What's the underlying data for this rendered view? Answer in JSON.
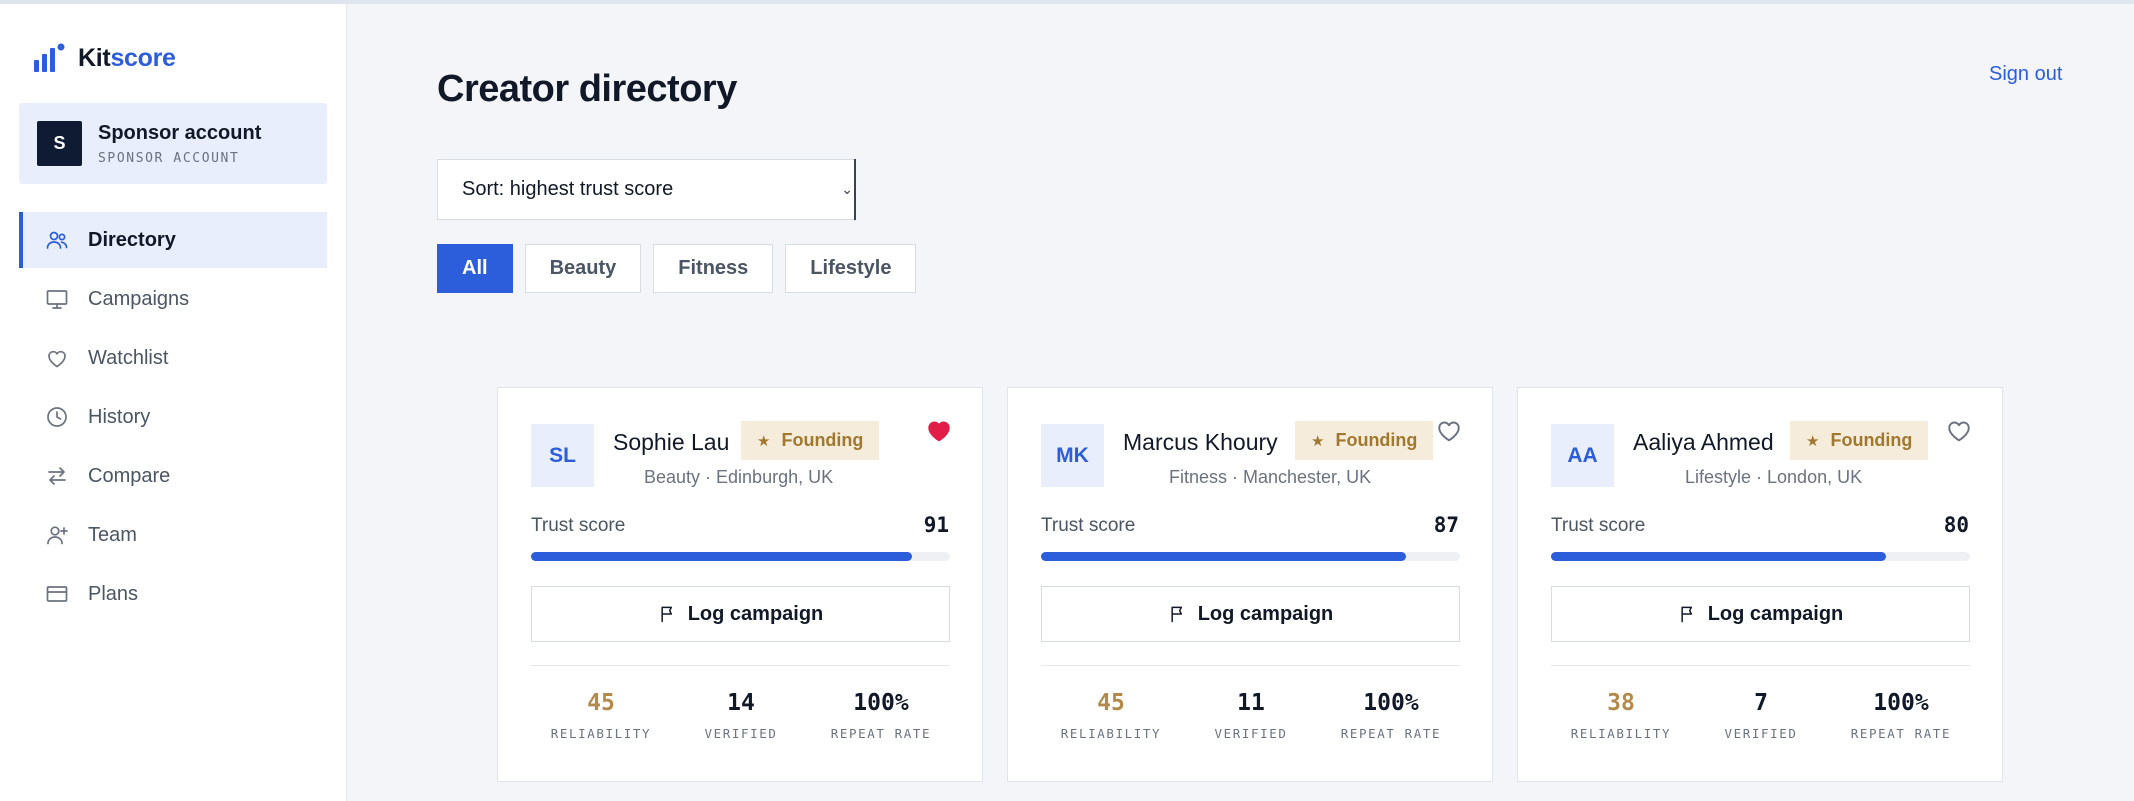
{
  "brand": {
    "prefix": "Kit",
    "accent": "score"
  },
  "account": {
    "initial": "S",
    "name": "Sponsor account",
    "role": "SPONSOR ACCOUNT"
  },
  "nav": [
    {
      "label": "Directory",
      "icon": "users-icon",
      "active": true
    },
    {
      "label": "Campaigns",
      "icon": "monitor-icon",
      "active": false
    },
    {
      "label": "Watchlist",
      "icon": "heart-icon",
      "active": false
    },
    {
      "label": "History",
      "icon": "clock-icon",
      "active": false
    },
    {
      "label": "Compare",
      "icon": "swap-icon",
      "active": false
    },
    {
      "label": "Team",
      "icon": "user-plus-icon",
      "active": false
    },
    {
      "label": "Plans",
      "icon": "credit-card-icon",
      "active": false
    }
  ],
  "header": {
    "title": "Creator directory",
    "signout": "Sign out"
  },
  "sort": {
    "selected": "Sort: highest trust score"
  },
  "filters": [
    {
      "label": "All",
      "active": true
    },
    {
      "label": "Beauty",
      "active": false
    },
    {
      "label": "Fitness",
      "active": false
    },
    {
      "label": "Lifestyle",
      "active": false
    }
  ],
  "colors": {
    "accent": "#2c5ddb",
    "badge_bg": "#f6ecdc",
    "badge_text": "#a0782e",
    "heart_active": "#e11d48"
  },
  "cards": [
    {
      "initials": "SL",
      "name": "Sophie Lau",
      "badge": "Founding",
      "watchlisted": true,
      "meta": "Beauty · Edinburgh, UK",
      "trust_label": "Trust score",
      "trust_score": 91,
      "log_label": "Log campaign",
      "stats": [
        {
          "value": "45",
          "label": "RELIABILITY"
        },
        {
          "value": "14",
          "label": "VERIFIED"
        },
        {
          "value": "100%",
          "label": "REPEAT RATE"
        }
      ]
    },
    {
      "initials": "MK",
      "name": "Marcus Khoury",
      "badge": "Founding",
      "watchlisted": false,
      "meta": "Fitness · Manchester, UK",
      "trust_label": "Trust score",
      "trust_score": 87,
      "log_label": "Log campaign",
      "stats": [
        {
          "value": "45",
          "label": "RELIABILITY"
        },
        {
          "value": "11",
          "label": "VERIFIED"
        },
        {
          "value": "100%",
          "label": "REPEAT RATE"
        }
      ]
    },
    {
      "initials": "AA",
      "name": "Aaliya Ahmed",
      "badge": "Founding",
      "watchlisted": false,
      "meta": "Lifestyle · London, UK",
      "trust_label": "Trust score",
      "trust_score": 80,
      "log_label": "Log campaign",
      "stats": [
        {
          "value": "38",
          "label": "RELIABILITY"
        },
        {
          "value": "7",
          "label": "VERIFIED"
        },
        {
          "value": "100%",
          "label": "REPEAT RATE"
        }
      ]
    }
  ]
}
